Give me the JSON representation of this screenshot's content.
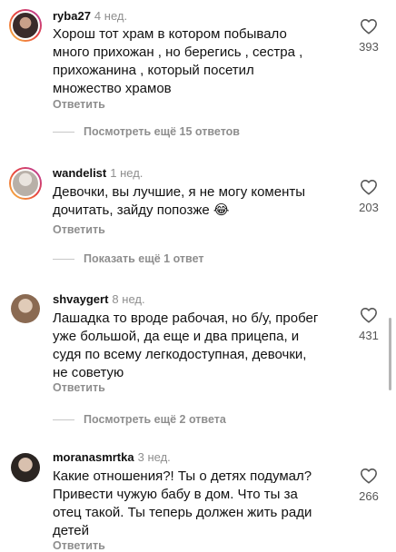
{
  "comments": [
    {
      "username": "ryba27",
      "time": "4 нед.",
      "text": "Хорош тот храм в котором побывало много прихожан , но берегись , сестра , прихожанина , который посетил множество храмов",
      "likes": "393",
      "reply_label": "Ответить",
      "more_label": "Посмотреть ещё 15 ответов",
      "avatar_colors": [
        "#3a2b2a",
        "#c9a08a"
      ]
    },
    {
      "username": "wandelist",
      "time": "1 нед.",
      "text": "Девочки, вы лучшие, я не могу коменты дочитать, зайду попозже 😂",
      "likes": "203",
      "reply_label": "Ответить",
      "more_label": "Показать ещё 1 ответ",
      "avatar_colors": [
        "#b8b0a8",
        "#e9e4de"
      ]
    },
    {
      "username": "shvaygert",
      "time": "8 нед.",
      "text": "Лашадка то вроде рабочая, но б/у, пробег уже большой, да еще и два прицепа, и судя по всему легкодоступная, девочки, не советую",
      "likes": "431",
      "reply_label": "Ответить",
      "more_label": "Посмотреть ещё 2 ответа",
      "avatar_colors": [
        "#8a6a52",
        "#e0cbb8"
      ]
    },
    {
      "username": "moranasmrtka",
      "time": "3 нед.",
      "text": "Какие отношения?! Ты о детях подумал? Привести чужую бабу в дом. Что ты за отец такой. Ты теперь должен жить ради детей",
      "likes": "266",
      "reply_label": "Ответить",
      "avatar_colors": [
        "#2b2522",
        "#d8c0ae"
      ]
    }
  ],
  "icons": {
    "like": "heart-outline-icon"
  }
}
